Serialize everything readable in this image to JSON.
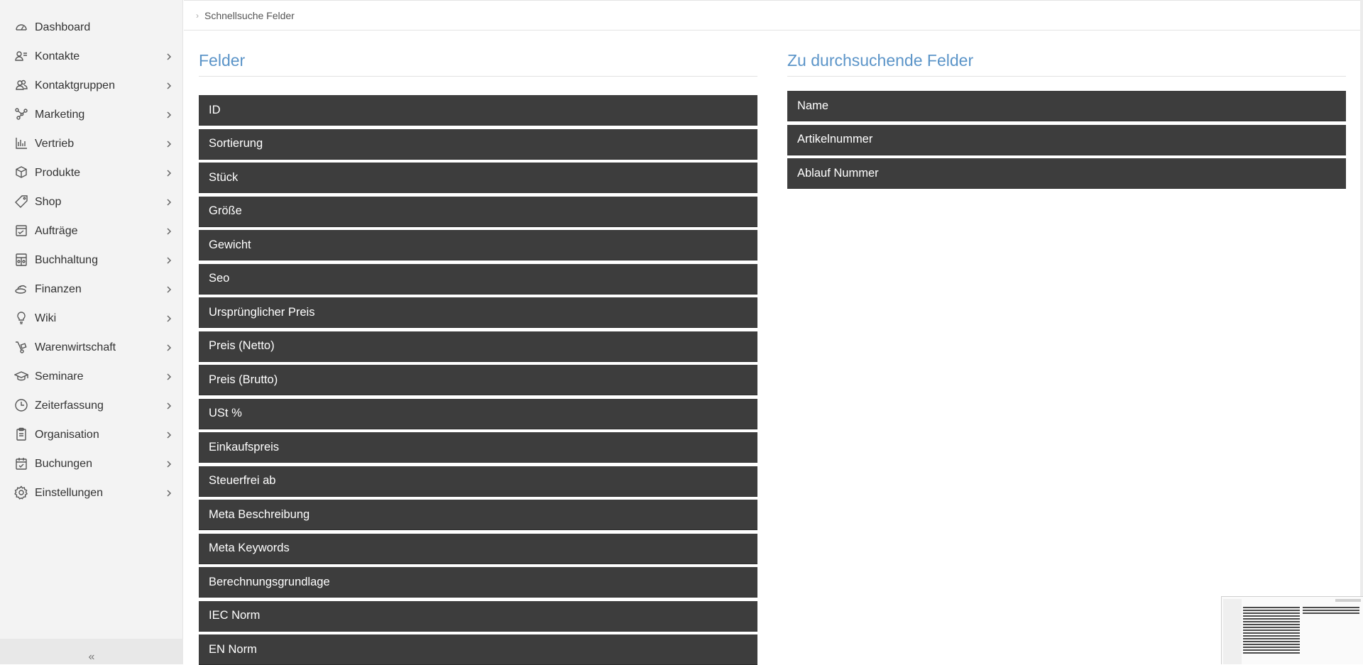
{
  "sidebar": {
    "items": [
      {
        "label": "Dashboard",
        "icon": "dashboard-icon",
        "has_chevron": false
      },
      {
        "label": "Kontakte",
        "icon": "contacts-icon",
        "has_chevron": true
      },
      {
        "label": "Kontaktgruppen",
        "icon": "contact-groups-icon",
        "has_chevron": true
      },
      {
        "label": "Marketing",
        "icon": "marketing-network-icon",
        "has_chevron": true
      },
      {
        "label": "Vertrieb",
        "icon": "bar-chart-icon",
        "has_chevron": true
      },
      {
        "label": "Produkte",
        "icon": "box-icon",
        "has_chevron": true
      },
      {
        "label": "Shop",
        "icon": "tag-icon",
        "has_chevron": true
      },
      {
        "label": "Aufträge",
        "icon": "orders-icon",
        "has_chevron": true
      },
      {
        "label": "Buchhaltung",
        "icon": "accounting-icon",
        "has_chevron": true
      },
      {
        "label": "Finanzen",
        "icon": "coins-icon",
        "has_chevron": true
      },
      {
        "label": "Wiki",
        "icon": "lightbulb-icon",
        "has_chevron": true
      },
      {
        "label": "Warenwirtschaft",
        "icon": "hand-truck-icon",
        "has_chevron": true
      },
      {
        "label": "Seminare",
        "icon": "graduation-cap-icon",
        "has_chevron": true
      },
      {
        "label": "Zeiterfassung",
        "icon": "clock-icon",
        "has_chevron": true
      },
      {
        "label": "Organisation",
        "icon": "clipboard-icon",
        "has_chevron": true
      },
      {
        "label": "Buchungen",
        "icon": "calendar-check-icon",
        "has_chevron": true
      },
      {
        "label": "Einstellungen",
        "icon": "gear-icon",
        "has_chevron": true
      }
    ],
    "collapse_label": "«"
  },
  "breadcrumb": {
    "separator": "›",
    "current": "Schnellsuche Felder"
  },
  "panels": {
    "available": {
      "title": "Felder",
      "items": [
        "ID",
        "Sortierung",
        "Stück",
        "Größe",
        "Gewicht",
        "Seo",
        "Ursprünglicher Preis",
        "Preis (Netto)",
        "Preis (Brutto)",
        "USt %",
        "Einkaufspreis",
        "Steuerfrei ab",
        "Meta Beschreibung",
        "Meta Keywords",
        "Berechnungsgrundlage",
        "IEC Norm",
        "EN Norm"
      ]
    },
    "searchable": {
      "title": "Zu durchsuchende Felder",
      "items": [
        "Name",
        "Artikelnummer",
        "Ablauf Nummer"
      ]
    }
  },
  "colors": {
    "accent": "#5b94c8",
    "item_bg": "#3d3d3d",
    "sidebar_bg": "#f3f3f3"
  }
}
